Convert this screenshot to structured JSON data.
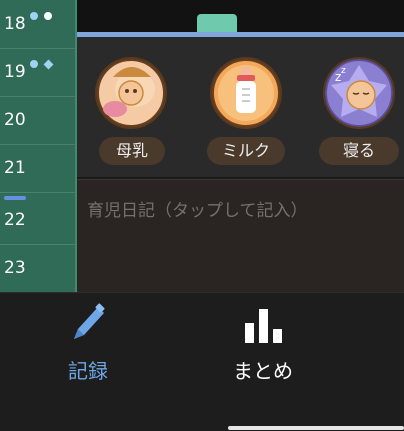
{
  "hours": [
    {
      "label": "18",
      "markers": [
        "dot-lightblue",
        "dot-white"
      ]
    },
    {
      "label": "19",
      "markers": [
        "dot-lightblue",
        "diamond-lightblue"
      ]
    },
    {
      "label": "20",
      "markers": []
    },
    {
      "label": "21",
      "markers": []
    },
    {
      "label": "22",
      "markers": []
    },
    {
      "label": "23",
      "markers": []
    }
  ],
  "actions": [
    {
      "label": "母乳",
      "icon": "baby-breastfeeding-icon"
    },
    {
      "label": "ミルク",
      "icon": "milk-bottle-icon"
    },
    {
      "label": "寝る",
      "icon": "sleeping-baby-icon"
    }
  ],
  "diary": {
    "placeholder": "育児日記（タップして記入）"
  },
  "nav": [
    {
      "label": "記録",
      "icon": "pencil-icon",
      "active": true
    },
    {
      "label": "まとめ",
      "icon": "bar-chart-icon",
      "active": false
    }
  ],
  "colors": {
    "ruler_bg": "#2f6b57",
    "accent_blue": "#6fa6e6",
    "marker_lightblue": "#9fd4f0",
    "pill_bg": "#4a3a2c"
  }
}
